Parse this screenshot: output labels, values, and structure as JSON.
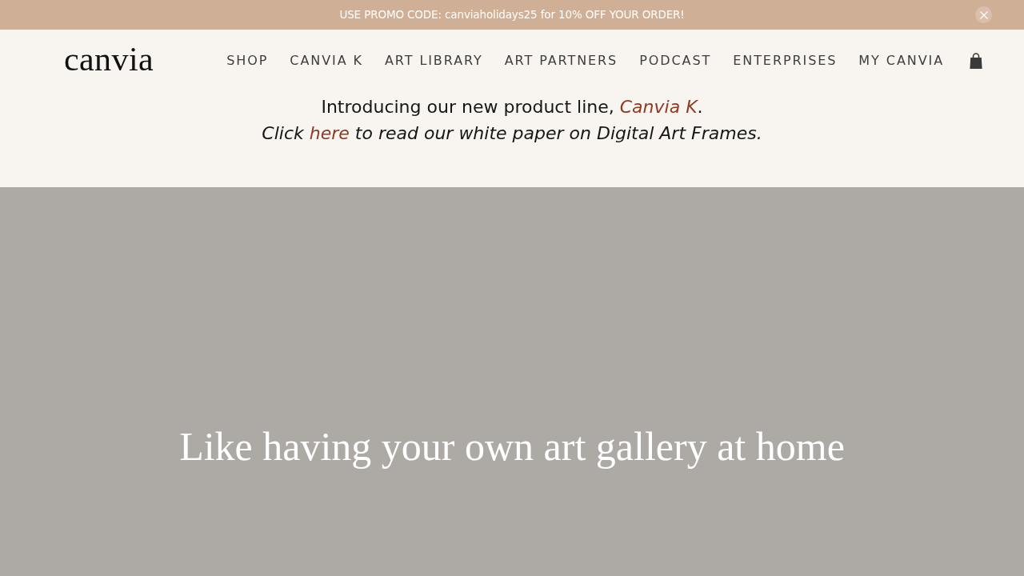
{
  "promo_bar": {
    "text": "USE PROMO CODE: canviaholidays25 for 10% OFF YOUR ORDER!"
  },
  "header": {
    "logo": "canvia",
    "nav": [
      "SHOP",
      "CANVIA K",
      "ART LIBRARY",
      "ART PARTNERS",
      "PODCAST",
      "ENTERPRISES",
      "MY CANVIA"
    ]
  },
  "announcement": {
    "lines": [
      {
        "italic": false,
        "segments": [
          {
            "text": "Introducing our new product line, ",
            "link": false
          },
          {
            "text": "Canvia K",
            "link": true
          },
          {
            "text": ".",
            "link": false
          }
        ]
      },
      {
        "italic": true,
        "segments": [
          {
            "text": "Click ",
            "link": false
          },
          {
            "text": "here",
            "link": true
          },
          {
            "text": " to read our white paper on Digital Art Frames.",
            "link": false
          }
        ]
      }
    ]
  },
  "hero": {
    "heading": "Like having your own art gallery at home"
  }
}
